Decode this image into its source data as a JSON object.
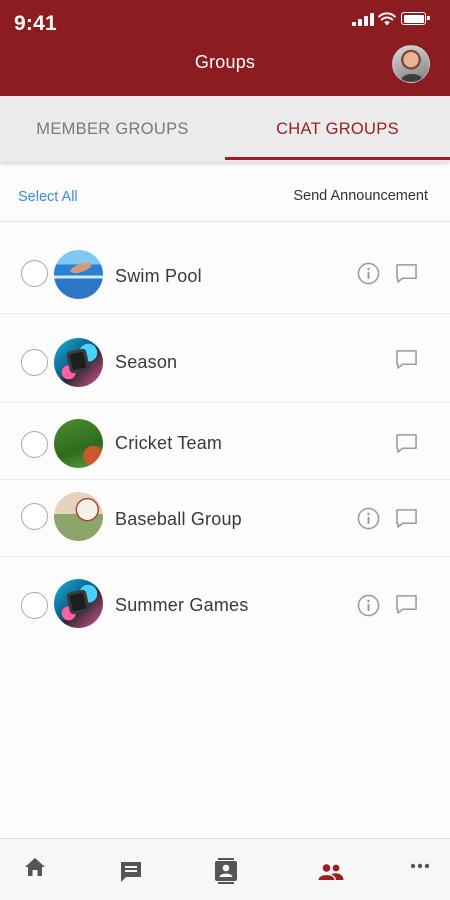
{
  "status_bar": {
    "time": "9:41"
  },
  "header": {
    "title": "Groups"
  },
  "tabs": [
    {
      "label": "MEMBER GROUPS",
      "active": false
    },
    {
      "label": "CHAT GROUPS",
      "active": true
    }
  ],
  "actions": {
    "select_all": "Select All",
    "send_announcement": "Send Announcement"
  },
  "groups": [
    {
      "name": "Swim Pool",
      "image": "swimmer-photo",
      "has_info": true
    },
    {
      "name": "Season",
      "image": "cube-art-photo",
      "has_info": false
    },
    {
      "name": "Cricket Team",
      "image": "cricket-ball-photo",
      "has_info": false
    },
    {
      "name": "Baseball Group",
      "image": "baseball-photo",
      "has_info": true
    },
    {
      "name": "Summer Games",
      "image": "cube-art-photo",
      "has_info": true
    }
  ],
  "bottom_nav": [
    {
      "icon": "home-icon",
      "active": false
    },
    {
      "icon": "messages-icon",
      "active": false
    },
    {
      "icon": "contacts-icon",
      "active": false
    },
    {
      "icon": "groups-icon",
      "active": true
    },
    {
      "icon": "more-icon",
      "active": false
    }
  ],
  "colors": {
    "brand": "#8c1c1f",
    "accent": "#9c1d22",
    "link": "#3a8dd6"
  }
}
